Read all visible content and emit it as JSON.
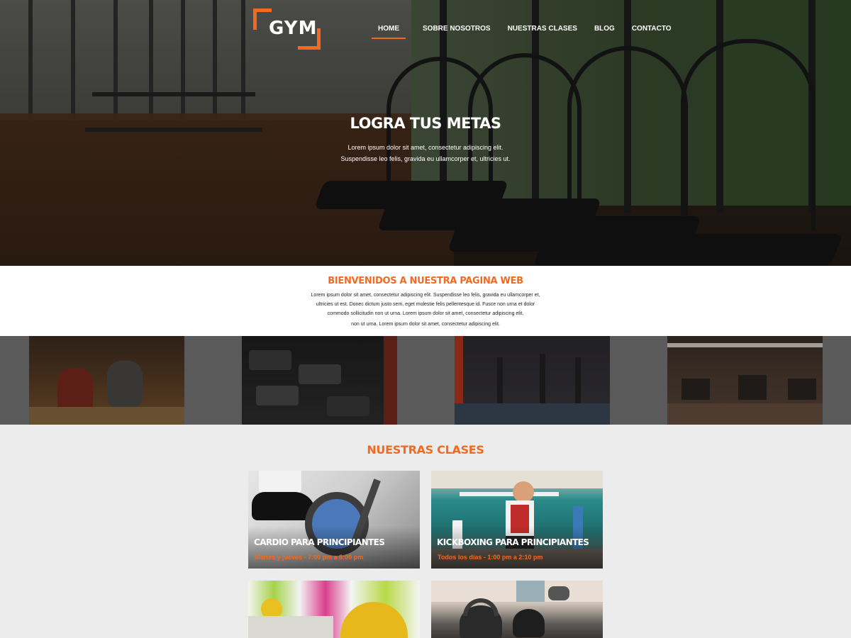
{
  "brand": {
    "logo_text": "GYM",
    "accent_color": "#f26a21"
  },
  "nav": {
    "items": [
      {
        "label": "HOME",
        "active": true
      },
      {
        "label": "SOBRE NOSOTROS",
        "active": false
      },
      {
        "label": "NUESTRAS CLASES",
        "active": false
      },
      {
        "label": "BLOG",
        "active": false
      },
      {
        "label": "CONTACTO",
        "active": false
      }
    ]
  },
  "hero": {
    "title": "LOGRA TUS METAS",
    "subtitle_line1": "Lorem ipsum dolor sit amet, consectetur adipiscing elit.",
    "subtitle_line2": "Suspendisse leo felis, gravida eu ullamcorper et, ultricies ut."
  },
  "welcome": {
    "title": "BIENVENIDOS A NUESTRA PAGINA WEB",
    "paragraph": "Lorem ipsum dolor sit amet, consectetur adipiscing elit. Suspendisse leo felis, gravida eu ullamcorper et, ultricies ut est. Donec dictum justo sem, eget molestie felis pellentesque id. Fusce non urna et dolor commodo sollicitudin non ut urna. Lorem ipsum dolor sit amet, consectetur adipiscing elit.",
    "paragraph2": "non ut urna. Lorem ipsum dolor sit amet, consectetur adipiscing elit."
  },
  "classes": {
    "title": "NUESTRAS CLASES",
    "cards": [
      {
        "title": "CARDIO PARA PRINCIPIANTES",
        "time": "Martes y jueves - 7:00 pm a 8:00 pm"
      },
      {
        "title": "KICKBOXING PARA PRINCIPIANTES",
        "time": "Todos los días - 1:00 pm a 2:10 pm"
      },
      {
        "title": "",
        "time": ""
      },
      {
        "title": "",
        "time": ""
      }
    ]
  }
}
